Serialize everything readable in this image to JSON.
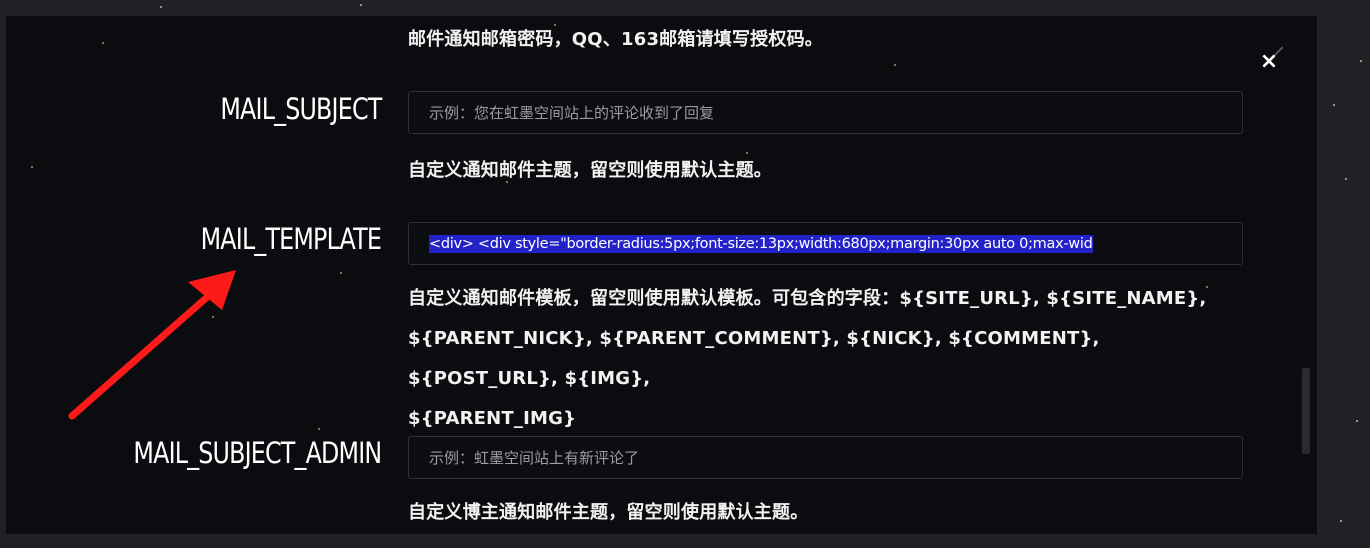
{
  "top_help": "邮件通知邮箱密码，QQ、163邮箱请填写授权码。",
  "fields": [
    {
      "label": "MAIL_SUBJECT",
      "placeholder": "示例：您在虹墨空间站上的评论收到了回复",
      "value": "",
      "help": "自定义通知邮件主题，留空则使用默认主题。"
    },
    {
      "label": "MAIL_TEMPLATE",
      "placeholder": "",
      "value": "<div>   <div style=\"border-radius:5px;font-size:13px;width:680px;margin:30px auto 0;max-wid",
      "help_lines": [
        "自定义通知邮件模板，留空则使用默认模板。可包含的字段：${SITE_URL}, ${SITE_NAME},",
        "${PARENT_NICK}, ${PARENT_COMMENT}, ${NICK}, ${COMMENT}, ${POST_URL}, ${IMG},",
        "${PARENT_IMG}"
      ]
    },
    {
      "label": "MAIL_SUBJECT_ADMIN",
      "placeholder": "示例：虹墨空间站上有新评论了",
      "value": "",
      "help": "自定义博主通知邮件主题，留空则使用默认主题。"
    }
  ],
  "close_label": "×",
  "colors": {
    "modal_bg": "#0b0c0f",
    "selection": "#2222c8",
    "arrow": "#ff1a1a"
  }
}
